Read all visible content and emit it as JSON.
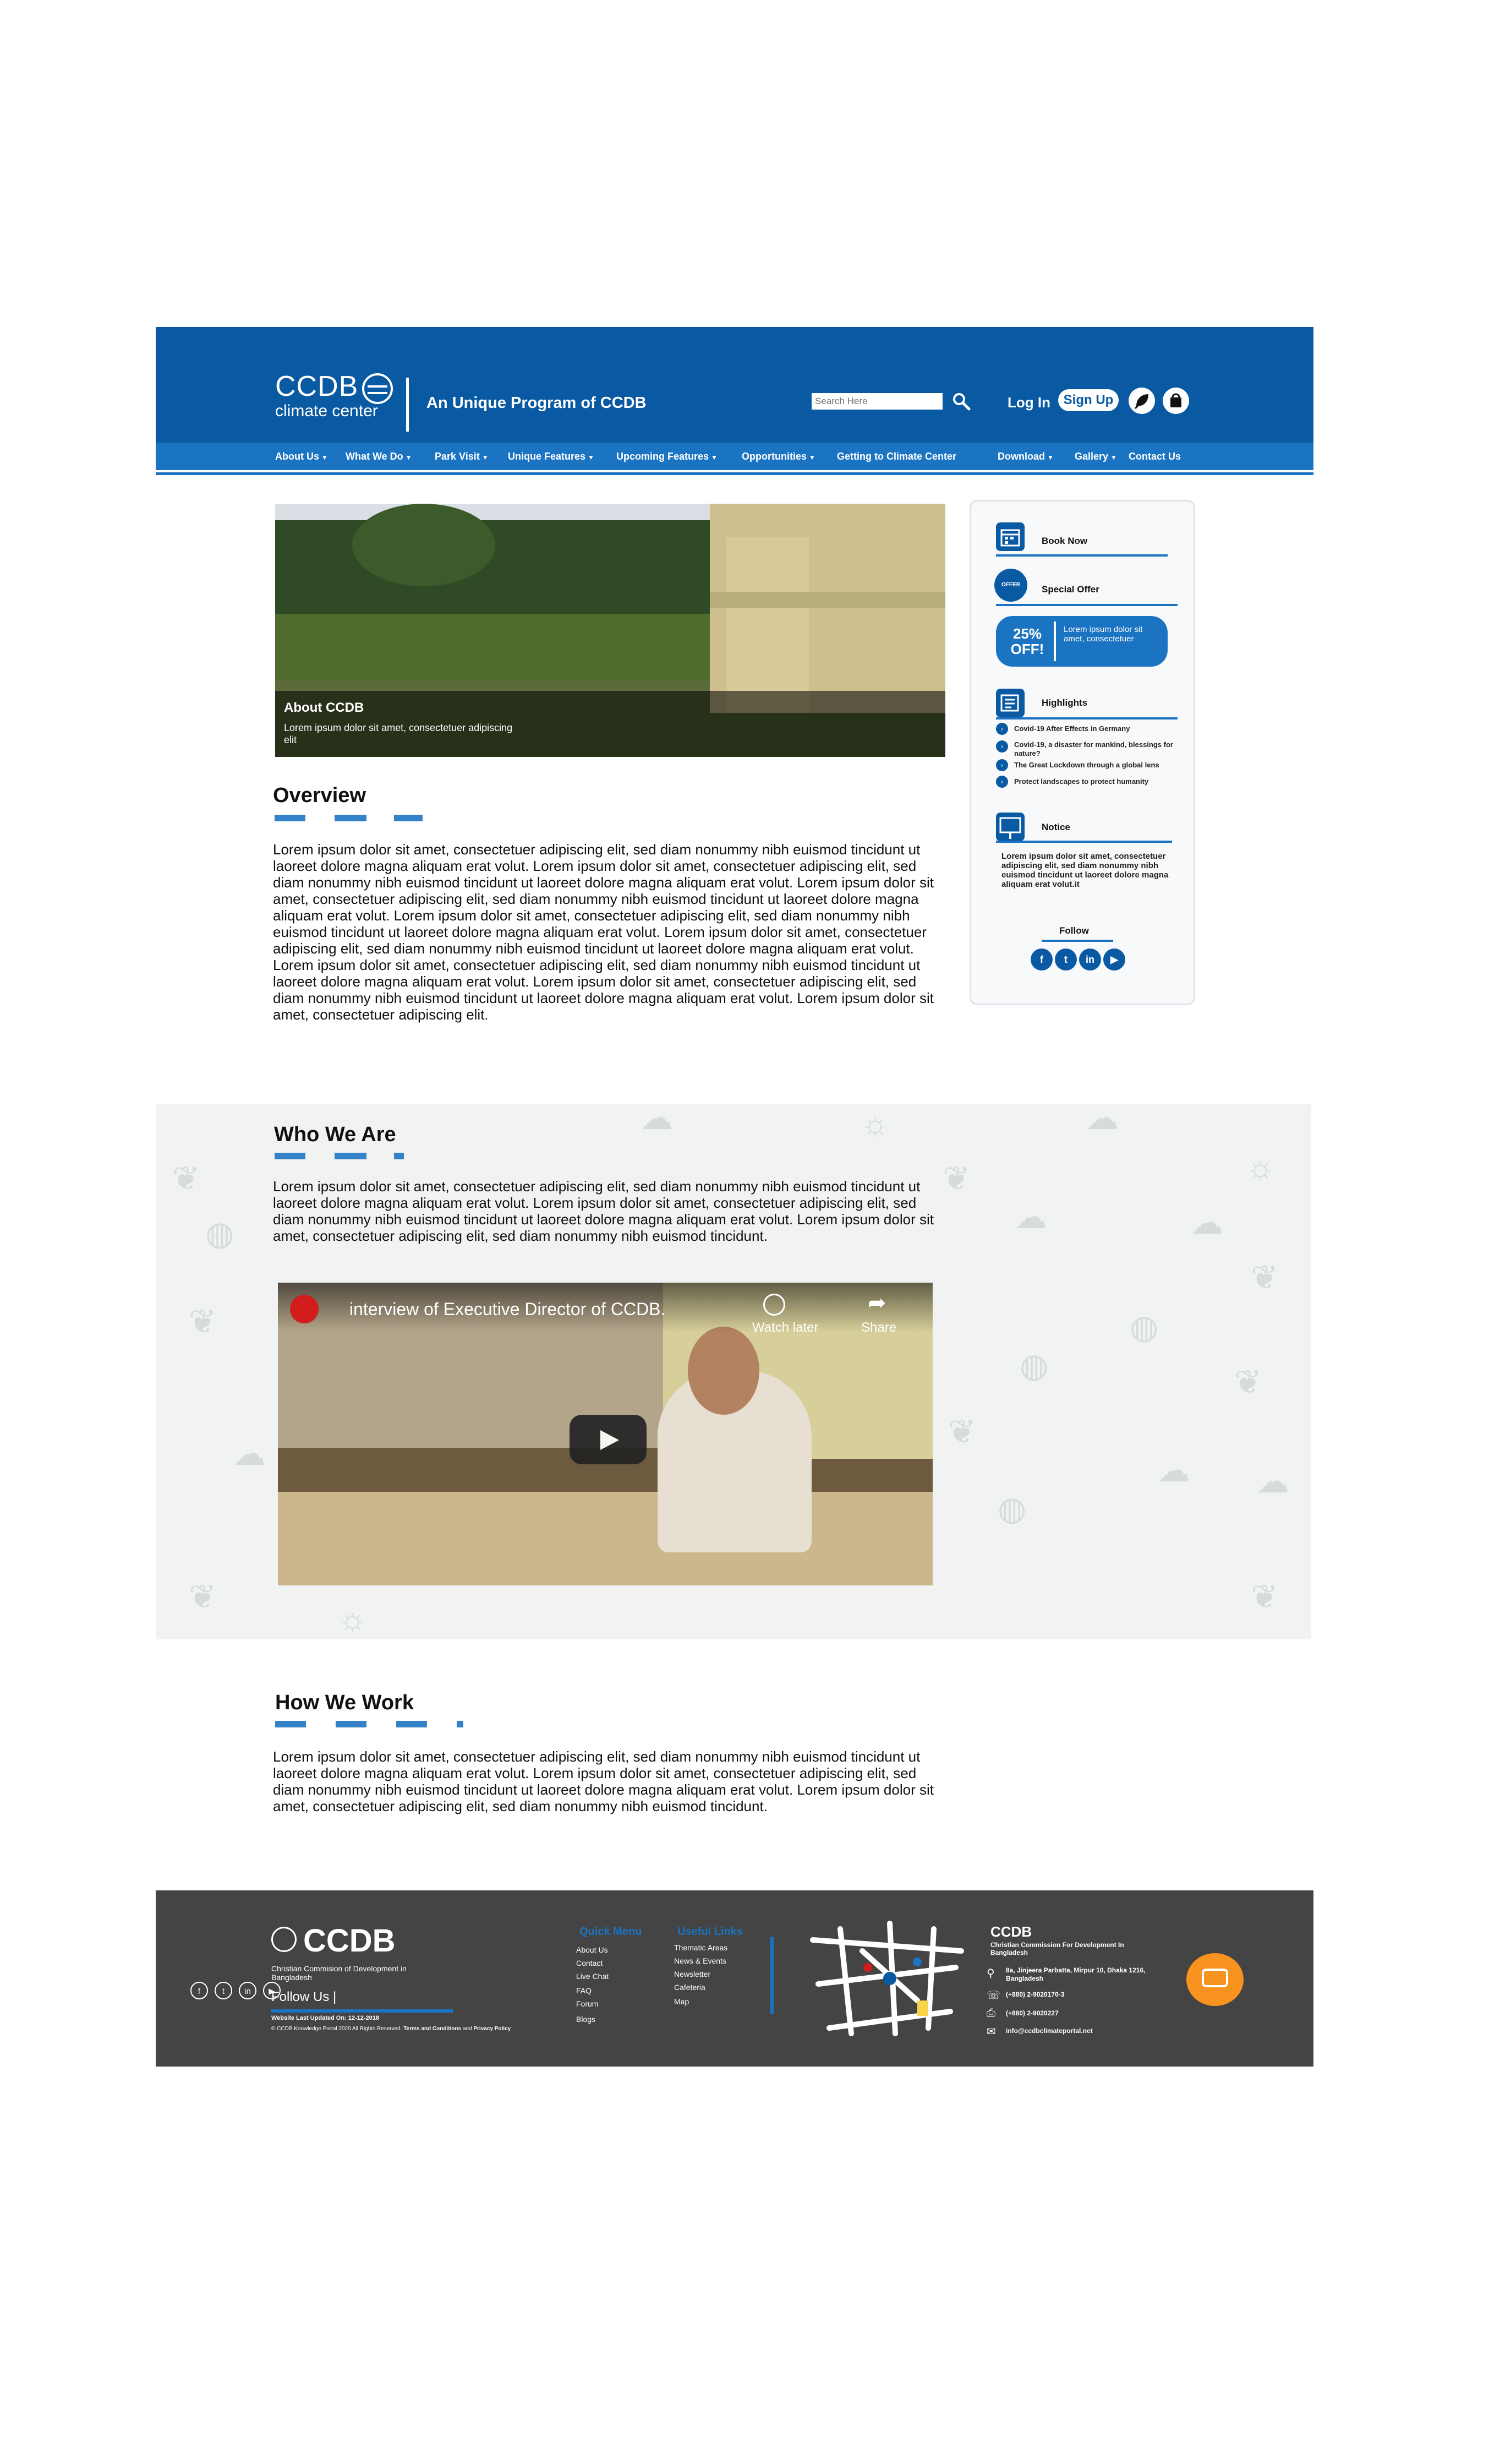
{
  "header": {
    "logo_line1": "CCDB",
    "logo_line2": "climate center",
    "tagline": "An Unique Program of CCDB",
    "search_placeholder": "Search Here",
    "login": "Log In",
    "signup": "Sign Up",
    "brand_color": "#0a5aa3",
    "nav_color": "#1b74c2"
  },
  "nav": {
    "items": [
      "About Us",
      "What We Do",
      "Park Visit",
      "Unique Features",
      "Upcoming Features",
      "Opportunities",
      "Getting to Climate Center",
      "Download",
      "Gallery",
      "Contact Us"
    ],
    "caret": "▼"
  },
  "hero": {
    "title": "About CCDB",
    "subtitle": "Lorem ipsum dolor sit amet, consectetuer adipiscing elit"
  },
  "sidebar": {
    "book_now": "Book Now",
    "special_offer": "Special Offer",
    "offer_badge": "OFFER",
    "discount": "25% OFF!",
    "offer_text": "Lorem ipsum dolor sit amet, consectetuer",
    "highlights_title": "Highlights",
    "highlights": [
      "Covid-19 After Effects in Germany",
      "Covid-19, a disaster for mankind, blessings for nature?",
      "The Great Lockdown through a global lens",
      "Protect landscapes to protect humanity"
    ],
    "notice_title": "Notice",
    "notice_text": "Lorem ipsum dolor sit amet, consectetuer adipiscing elit, sed diam nonummy nibh euismod tincidunt ut laoreet dolore magna aliquam erat volut.it",
    "follow": "Follow",
    "social": [
      "f",
      "t",
      "in",
      "▶"
    ]
  },
  "overview": {
    "title": "Overview",
    "text": "Lorem ipsum dolor sit amet, consectetuer adipiscing elit, sed diam nonummy nibh euismod tincidunt ut laoreet dolore magna aliquam erat volut. Lorem ipsum dolor sit amet, consectetuer adipiscing elit, sed diam nonummy nibh euismod tincidunt ut laoreet dolore magna aliquam erat volut. Lorem ipsum dolor sit amet, consectetuer adipiscing elit, sed diam nonummy nibh euismod tincidunt ut laoreet dolore magna aliquam erat volut. Lorem ipsum dolor sit amet, consectetuer adipiscing elit, sed diam nonummy nibh euismod tincidunt ut laoreet dolore magna aliquam erat volut. Lorem ipsum dolor sit amet, consectetuer adipiscing elit, sed diam nonummy nibh euismod tincidunt ut laoreet dolore magna aliquam erat volut. Lorem ipsum dolor sit amet, consectetuer adipiscing elit, sed diam nonummy nibh euismod tincidunt ut laoreet dolore magna aliquam erat volut. Lorem ipsum dolor sit amet, consectetuer adipiscing elit, sed diam nonummy nibh euismod tincidunt ut laoreet dolore magna aliquam erat volut. Lorem ipsum dolor sit amet, consectetuer adipiscing elit."
  },
  "who": {
    "title": "Who We Are",
    "text": "Lorem ipsum dolor sit amet, consectetuer adipiscing elit, sed diam nonummy nibh euismod tincidunt ut laoreet dolore magna aliquam erat volut. Lorem ipsum dolor sit amet, consectetuer adipiscing elit, sed diam nonummy nibh euismod tincidunt ut laoreet dolore magna aliquam erat volut. Lorem ipsum dolor sit amet, consectetuer adipiscing elit, sed diam nonummy nibh euismod tincidunt.",
    "video_title": "interview of Executive Director of CCDB.",
    "watch_later": "Watch later",
    "share": "Share"
  },
  "how": {
    "title": "How We Work",
    "text": "Lorem ipsum dolor sit amet, consectetuer adipiscing elit, sed diam nonummy nibh euismod tincidunt ut laoreet dolore magna aliquam erat volut. Lorem ipsum dolor sit amet, consectetuer adipiscing elit, sed diam nonummy nibh euismod tincidunt ut laoreet dolore magna aliquam erat volut. Lorem ipsum dolor sit amet, consectetuer adipiscing elit, sed diam nonummy nibh euismod tincidunt."
  },
  "footer": {
    "brand": "CCDB",
    "brand_sub": "Christian Commision of Development in Bangladesh",
    "follow_us": "Follow Us |",
    "social": [
      "f",
      "t",
      "in",
      "▶"
    ],
    "updated": "Website Last Updated On: 12-12-2018",
    "copyright": "© CCDB Knowledge Portal 2020 All Rights Reserved.",
    "terms": "Terms and Conditions",
    "and": "and",
    "privacy": "Privacy Policy",
    "quick_menu_title": "Quick Menu",
    "quick_menu": [
      "About Us",
      "Contact",
      "Live Chat",
      "FAQ",
      "Forum",
      "Blogs"
    ],
    "useful_links_title": "Useful Links",
    "useful_links": [
      "Thematic Areas",
      "News & Events",
      "Newsletter",
      "Cafeteria",
      "Map"
    ],
    "contact_title": "CCDB",
    "contact_sub": "Christian Commission For Development In Bangladesh",
    "address": "8a, Jinjeera Parbatta, Mirpur 10, Dhaka 1216, Bangladesh",
    "phone": "(+880) 2-9020170-3",
    "fax": "(+880) 2-9020227",
    "email": "info@ccdbclimateportal.net",
    "footer_bg": "#444444",
    "chat_color": "#f7931e"
  }
}
